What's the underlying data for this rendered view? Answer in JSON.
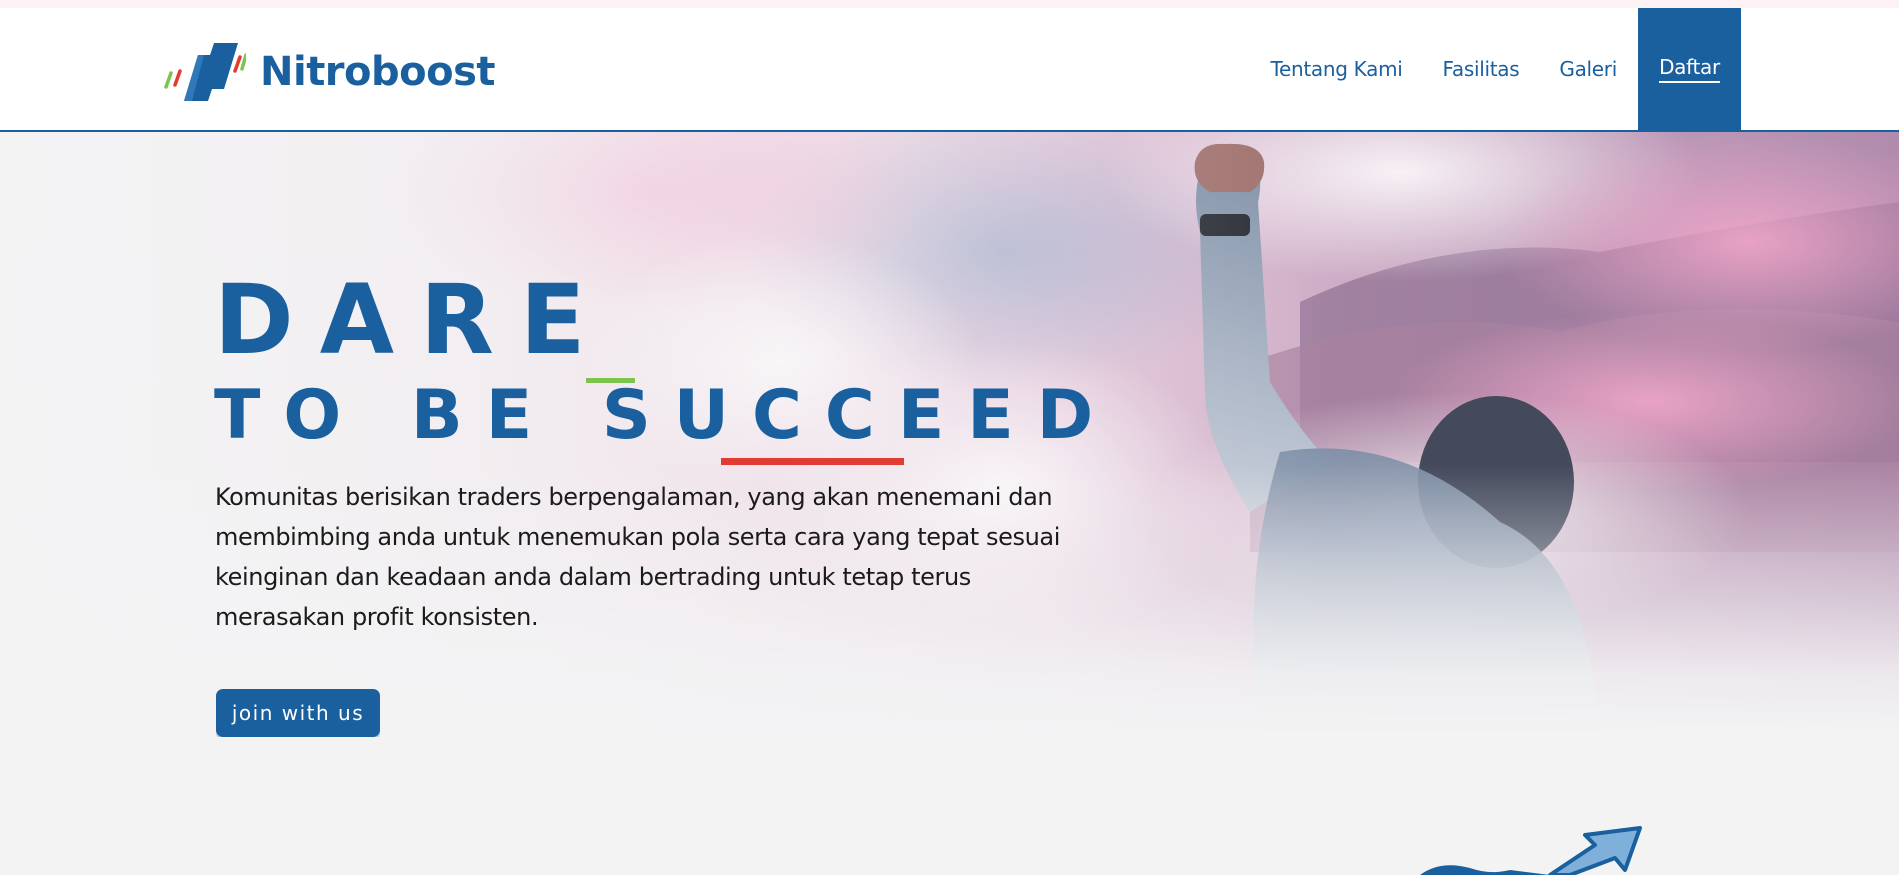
{
  "brand": {
    "name": "Nitroboost",
    "logo_icon": "nitroboost-n-logo-icon",
    "colors": {
      "primary": "#1a5f9e",
      "green": "#7cc44d",
      "red": "#e23c32"
    }
  },
  "nav": {
    "links": [
      {
        "label": "Tentang Kami"
      },
      {
        "label": "Fasilitas"
      },
      {
        "label": "Galeri"
      }
    ],
    "cta_label": "Daftar"
  },
  "hero": {
    "headline_line1": "DARE",
    "headline_line2": "TO BE SUCCEED",
    "description": "Komunitas berisikan traders berpengalaman, yang akan menemani dan membimbing anda untuk menemukan pola serta cara yang tepat sesuai keinginan dan keadaan anda dalam bertrading untuk tetap terus merasakan profit konsisten.",
    "button_label": "join with us",
    "image": "man-raising-fist-in-clouds-photo"
  },
  "next_section": {
    "image": "growth-arrow-illustration"
  }
}
